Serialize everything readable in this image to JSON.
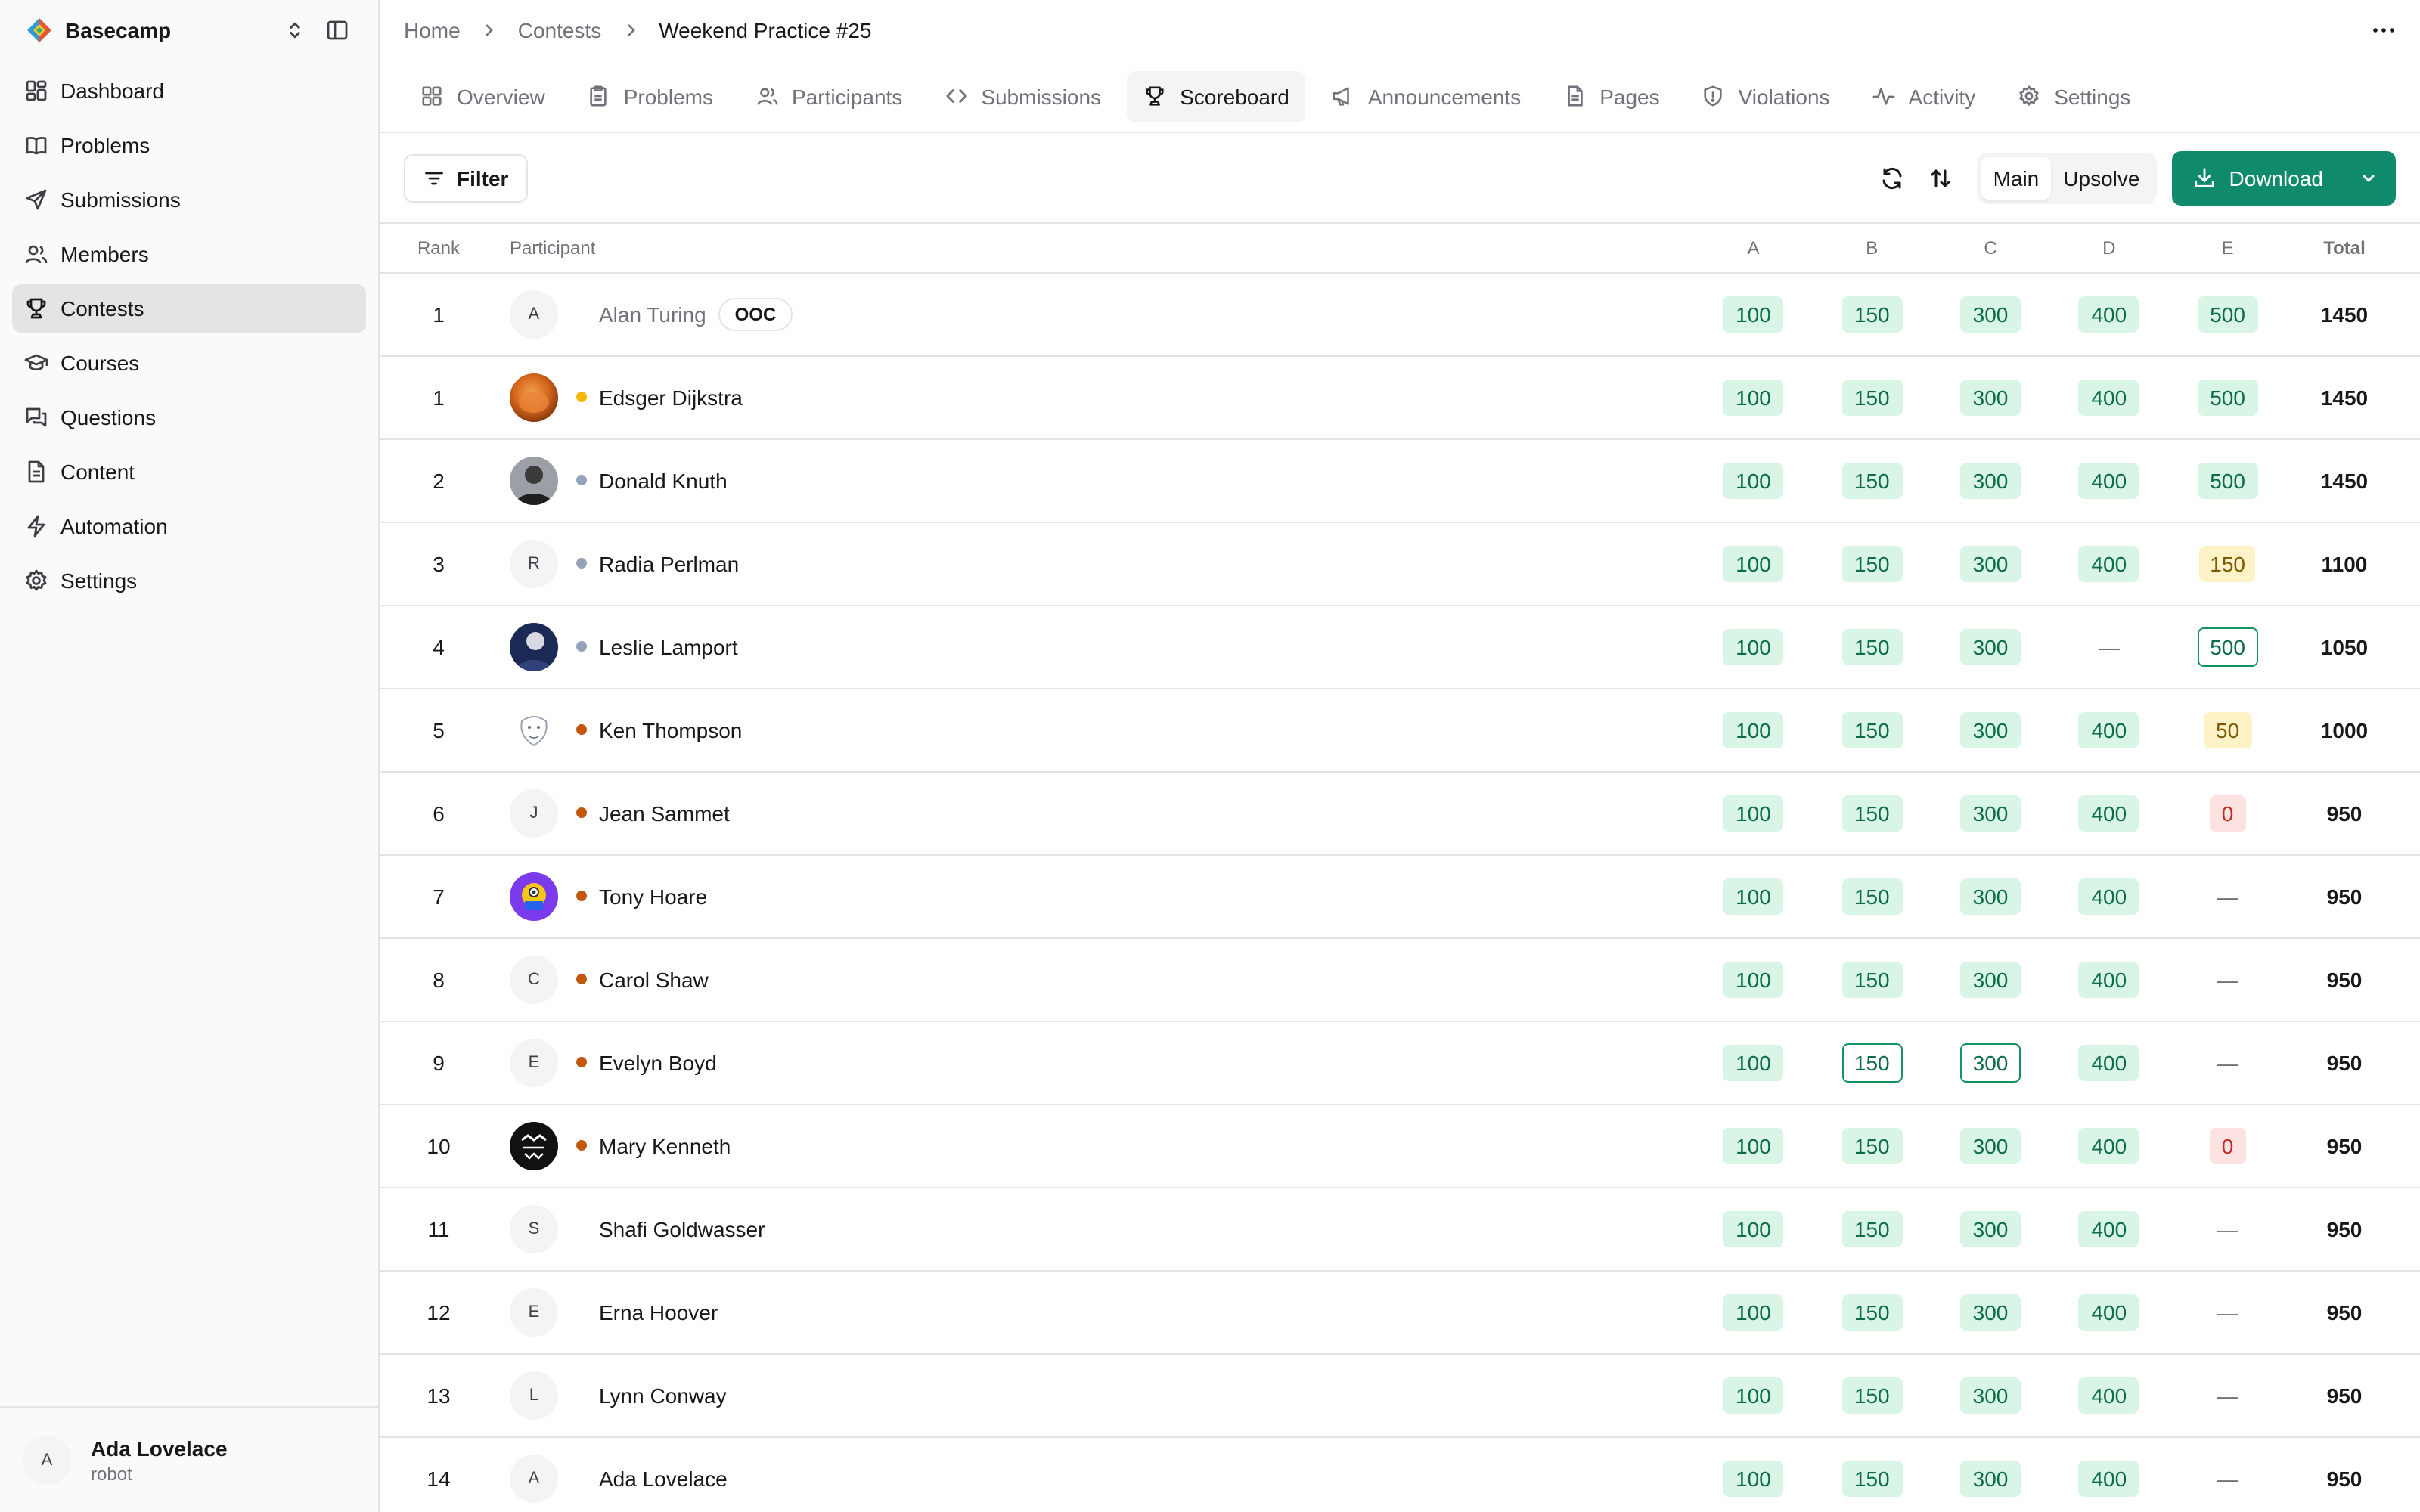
{
  "workspace": {
    "name": "Basecamp"
  },
  "sidebar": {
    "items": [
      {
        "label": "Dashboard",
        "icon": "dashboard-icon",
        "active": false
      },
      {
        "label": "Problems",
        "icon": "book-icon",
        "active": false
      },
      {
        "label": "Submissions",
        "icon": "send-icon",
        "active": false
      },
      {
        "label": "Members",
        "icon": "users-icon",
        "active": false
      },
      {
        "label": "Contests",
        "icon": "trophy-icon",
        "active": true
      },
      {
        "label": "Courses",
        "icon": "graduation-cap-icon",
        "active": false
      },
      {
        "label": "Questions",
        "icon": "chat-icon",
        "active": false
      },
      {
        "label": "Content",
        "icon": "document-icon",
        "active": false
      },
      {
        "label": "Automation",
        "icon": "bolt-icon",
        "active": false
      },
      {
        "label": "Settings",
        "icon": "gear-icon",
        "active": false
      }
    ]
  },
  "user": {
    "initial": "A",
    "name": "Ada Lovelace",
    "role": "robot"
  },
  "breadcrumb": {
    "home": "Home",
    "contests": "Contests",
    "current": "Weekend Practice #25"
  },
  "tabs": [
    {
      "label": "Overview",
      "icon": "grid-icon",
      "active": false
    },
    {
      "label": "Problems",
      "icon": "clipboard-icon",
      "active": false
    },
    {
      "label": "Participants",
      "icon": "users-icon",
      "active": false
    },
    {
      "label": "Submissions",
      "icon": "code-icon",
      "active": false
    },
    {
      "label": "Scoreboard",
      "icon": "trophy-icon",
      "active": true
    },
    {
      "label": "Announcements",
      "icon": "megaphone-icon",
      "active": false
    },
    {
      "label": "Pages",
      "icon": "document-icon",
      "active": false
    },
    {
      "label": "Violations",
      "icon": "shield-icon",
      "active": false
    },
    {
      "label": "Activity",
      "icon": "activity-icon",
      "active": false
    },
    {
      "label": "Settings",
      "icon": "gear-icon",
      "active": false
    }
  ],
  "toolbar": {
    "filter_label": "Filter",
    "mode_main": "Main",
    "mode_upsolve": "Upsolve",
    "active_mode": "Main",
    "download_label": "Download"
  },
  "colors": {
    "accent": "#0f8a6a",
    "dot_yellow": "#f5b800",
    "dot_gray": "#94a3b8",
    "dot_orange": "#c2570c"
  },
  "scoreboard": {
    "headers": {
      "rank": "Rank",
      "participant": "Participant",
      "problems": [
        "A",
        "B",
        "C",
        "D",
        "E"
      ],
      "total": "Total"
    },
    "rows": [
      {
        "rank": "1",
        "name": "Alan Turing",
        "avatar": "letter",
        "initial": "A",
        "dot": "none",
        "ooc": "OOC",
        "muted": true,
        "scores": [
          {
            "v": "100",
            "s": "green"
          },
          {
            "v": "150",
            "s": "green"
          },
          {
            "v": "300",
            "s": "green"
          },
          {
            "v": "400",
            "s": "green"
          },
          {
            "v": "500",
            "s": "green"
          }
        ],
        "total": "1450"
      },
      {
        "rank": "1",
        "name": "Edsger Dijkstra",
        "avatar": "orange-photo",
        "dot": "yellow",
        "scores": [
          {
            "v": "100",
            "s": "green"
          },
          {
            "v": "150",
            "s": "green"
          },
          {
            "v": "300",
            "s": "green"
          },
          {
            "v": "400",
            "s": "green"
          },
          {
            "v": "500",
            "s": "green"
          }
        ],
        "total": "1450"
      },
      {
        "rank": "2",
        "name": "Donald Knuth",
        "avatar": "dark-portrait-photo",
        "dot": "gray",
        "scores": [
          {
            "v": "100",
            "s": "green"
          },
          {
            "v": "150",
            "s": "green"
          },
          {
            "v": "300",
            "s": "green"
          },
          {
            "v": "400",
            "s": "green"
          },
          {
            "v": "500",
            "s": "green"
          }
        ],
        "total": "1450"
      },
      {
        "rank": "3",
        "name": "Radia Perlman",
        "avatar": "letter",
        "initial": "R",
        "dot": "gray",
        "scores": [
          {
            "v": "100",
            "s": "green"
          },
          {
            "v": "150",
            "s": "green"
          },
          {
            "v": "300",
            "s": "green"
          },
          {
            "v": "400",
            "s": "green"
          },
          {
            "v": "150",
            "s": "yellow"
          }
        ],
        "total": "1100"
      },
      {
        "rank": "4",
        "name": "Leslie Lamport",
        "avatar": "blue-photo",
        "dot": "gray",
        "scores": [
          {
            "v": "100",
            "s": "green"
          },
          {
            "v": "150",
            "s": "green"
          },
          {
            "v": "300",
            "s": "green"
          },
          {
            "v": "—",
            "s": "dash"
          },
          {
            "v": "500",
            "s": "green-outline"
          }
        ],
        "total": "1050"
      },
      {
        "rank": "5",
        "name": "Ken Thompson",
        "avatar": "sketch-photo",
        "dot": "orange",
        "scores": [
          {
            "v": "100",
            "s": "green"
          },
          {
            "v": "150",
            "s": "green"
          },
          {
            "v": "300",
            "s": "green"
          },
          {
            "v": "400",
            "s": "green"
          },
          {
            "v": "50",
            "s": "yellow"
          }
        ],
        "total": "1000"
      },
      {
        "rank": "6",
        "name": "Jean Sammet",
        "avatar": "letter",
        "initial": "J",
        "dot": "orange",
        "scores": [
          {
            "v": "100",
            "s": "green"
          },
          {
            "v": "150",
            "s": "green"
          },
          {
            "v": "300",
            "s": "green"
          },
          {
            "v": "400",
            "s": "green"
          },
          {
            "v": "0",
            "s": "red"
          }
        ],
        "total": "950"
      },
      {
        "rank": "7",
        "name": "Tony Hoare",
        "avatar": "purple-photo",
        "dot": "orange",
        "scores": [
          {
            "v": "100",
            "s": "green"
          },
          {
            "v": "150",
            "s": "green"
          },
          {
            "v": "300",
            "s": "green"
          },
          {
            "v": "400",
            "s": "green"
          },
          {
            "v": "—",
            "s": "dash"
          }
        ],
        "total": "950"
      },
      {
        "rank": "8",
        "name": "Carol Shaw",
        "avatar": "letter",
        "initial": "C",
        "dot": "orange",
        "scores": [
          {
            "v": "100",
            "s": "green"
          },
          {
            "v": "150",
            "s": "green"
          },
          {
            "v": "300",
            "s": "green"
          },
          {
            "v": "400",
            "s": "green"
          },
          {
            "v": "—",
            "s": "dash"
          }
        ],
        "total": "950"
      },
      {
        "rank": "9",
        "name": "Evelyn Boyd",
        "avatar": "letter",
        "initial": "E",
        "dot": "orange",
        "scores": [
          {
            "v": "100",
            "s": "green"
          },
          {
            "v": "150",
            "s": "green-outline"
          },
          {
            "v": "300",
            "s": "green-outline"
          },
          {
            "v": "400",
            "s": "green"
          },
          {
            "v": "—",
            "s": "dash"
          }
        ],
        "total": "950"
      },
      {
        "rank": "10",
        "name": "Mary Kenneth",
        "avatar": "black-logo-photo",
        "dot": "orange",
        "scores": [
          {
            "v": "100",
            "s": "green"
          },
          {
            "v": "150",
            "s": "green"
          },
          {
            "v": "300",
            "s": "green"
          },
          {
            "v": "400",
            "s": "green"
          },
          {
            "v": "0",
            "s": "red"
          }
        ],
        "total": "950"
      },
      {
        "rank": "11",
        "name": "Shafi Goldwasser",
        "avatar": "letter",
        "initial": "S",
        "dot": "none",
        "scores": [
          {
            "v": "100",
            "s": "green"
          },
          {
            "v": "150",
            "s": "green"
          },
          {
            "v": "300",
            "s": "green"
          },
          {
            "v": "400",
            "s": "green"
          },
          {
            "v": "—",
            "s": "dash"
          }
        ],
        "total": "950"
      },
      {
        "rank": "12",
        "name": "Erna Hoover",
        "avatar": "letter",
        "initial": "E",
        "dot": "none",
        "scores": [
          {
            "v": "100",
            "s": "green"
          },
          {
            "v": "150",
            "s": "green"
          },
          {
            "v": "300",
            "s": "green"
          },
          {
            "v": "400",
            "s": "green"
          },
          {
            "v": "—",
            "s": "dash"
          }
        ],
        "total": "950"
      },
      {
        "rank": "13",
        "name": "Lynn Conway",
        "avatar": "letter",
        "initial": "L",
        "dot": "none",
        "scores": [
          {
            "v": "100",
            "s": "green"
          },
          {
            "v": "150",
            "s": "green"
          },
          {
            "v": "300",
            "s": "green"
          },
          {
            "v": "400",
            "s": "green"
          },
          {
            "v": "—",
            "s": "dash"
          }
        ],
        "total": "950"
      },
      {
        "rank": "14",
        "name": "Ada Lovelace",
        "avatar": "letter",
        "initial": "A",
        "dot": "none",
        "scores": [
          {
            "v": "100",
            "s": "green"
          },
          {
            "v": "150",
            "s": "green"
          },
          {
            "v": "300",
            "s": "green"
          },
          {
            "v": "400",
            "s": "green"
          },
          {
            "v": "—",
            "s": "dash"
          }
        ],
        "total": "950"
      }
    ]
  }
}
